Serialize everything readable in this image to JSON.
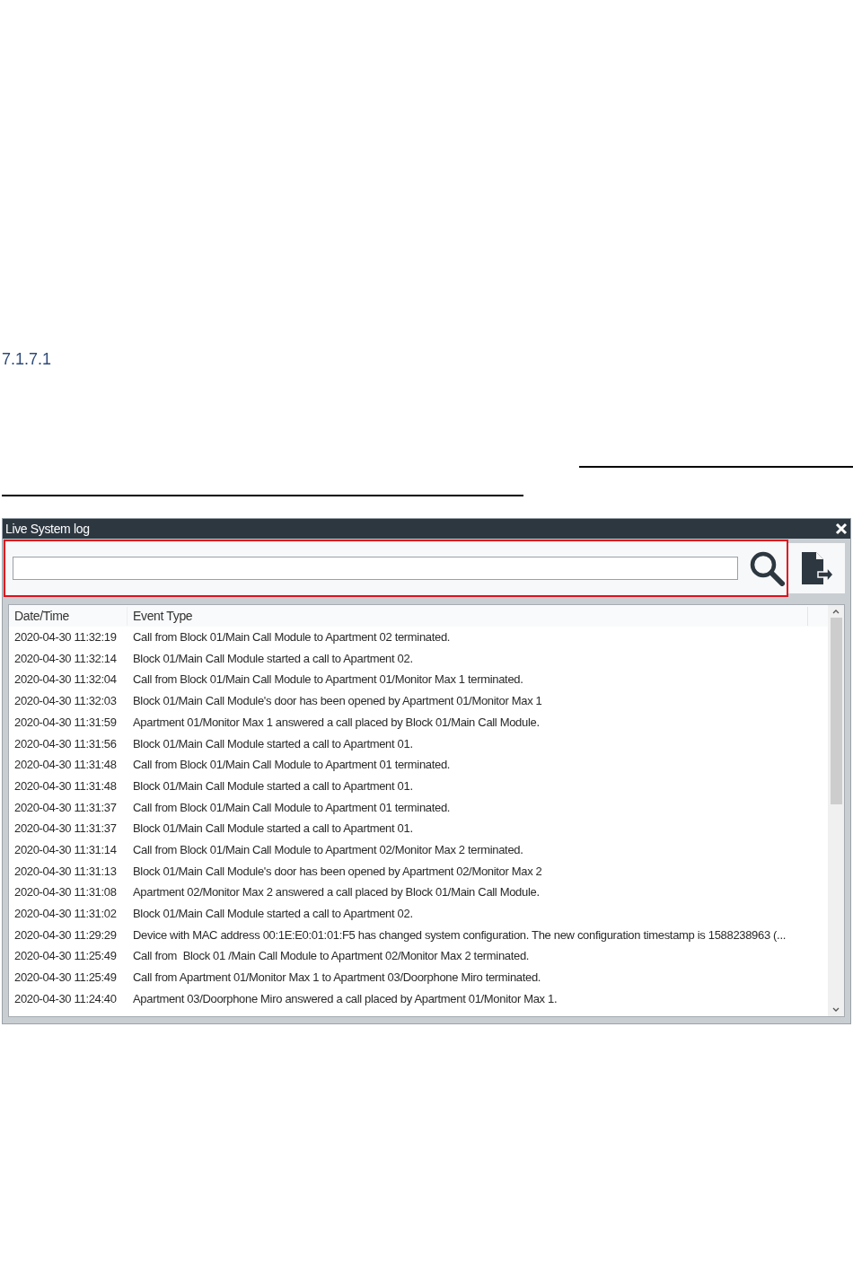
{
  "heading": "7.1.7.1",
  "window": {
    "title": "Live System log"
  },
  "table": {
    "columns": [
      "Date/Time",
      "Event Type"
    ],
    "rows": [
      {
        "date_time": "2020-04-30 11:32:19",
        "event_type": "Call from Block 01/Main Call Module to Apartment 02 terminated."
      },
      {
        "date_time": "2020-04-30 11:32:14",
        "event_type": "Block 01/Main Call Module started a call to Apartment 02."
      },
      {
        "date_time": "2020-04-30 11:32:04",
        "event_type": "Call from Block 01/Main Call Module to Apartment 01/Monitor Max 1 terminated."
      },
      {
        "date_time": "2020-04-30 11:32:03",
        "event_type": "Block 01/Main Call Module's door has been opened by Apartment 01/Monitor Max 1"
      },
      {
        "date_time": "2020-04-30 11:31:59",
        "event_type": "Apartment 01/Monitor Max 1 answered a call placed by Block 01/Main Call Module."
      },
      {
        "date_time": "2020-04-30 11:31:56",
        "event_type": "Block 01/Main Call Module started a call to Apartment 01."
      },
      {
        "date_time": "2020-04-30 11:31:48",
        "event_type": "Call from Block 01/Main Call Module to Apartment 01 terminated."
      },
      {
        "date_time": "2020-04-30 11:31:48",
        "event_type": "Block 01/Main Call Module started a call to Apartment 01."
      },
      {
        "date_time": "2020-04-30 11:31:37",
        "event_type": "Call from Block 01/Main Call Module to Apartment 01 terminated."
      },
      {
        "date_time": "2020-04-30 11:31:37",
        "event_type": "Block 01/Main Call Module started a call to Apartment 01."
      },
      {
        "date_time": "2020-04-30 11:31:14",
        "event_type": "Call from Block 01/Main Call Module to Apartment 02/Monitor Max 2 terminated."
      },
      {
        "date_time": "2020-04-30 11:31:13",
        "event_type": "Block 01/Main Call Module's door has been opened by Apartment 02/Monitor Max 2"
      },
      {
        "date_time": "2020-04-30 11:31:08",
        "event_type": "Apartment 02/Monitor Max 2 answered a call placed by Block 01/Main Call Module."
      },
      {
        "date_time": "2020-04-30 11:31:02",
        "event_type": "Block 01/Main Call Module started a call to Apartment 02."
      },
      {
        "date_time": "2020-04-30 11:29:29",
        "event_type": "Device with MAC address 00:1E:E0:01:01:F5 has changed system configuration. The new configuration timestamp is 1588238963 (..."
      },
      {
        "date_time": "2020-04-30 11:25:49",
        "event_type": "Call from  Block 01 /Main Call Module to Apartment 02/Monitor Max 2 terminated."
      },
      {
        "date_time": "2020-04-30 11:25:49",
        "event_type": "Call from Apartment 01/Monitor Max 1 to Apartment 03/Doorphone Miro terminated."
      },
      {
        "date_time": "2020-04-30 11:24:40",
        "event_type": "Apartment 03/Doorphone Miro answered a call placed by Apartment 01/Monitor Max 1."
      }
    ]
  }
}
